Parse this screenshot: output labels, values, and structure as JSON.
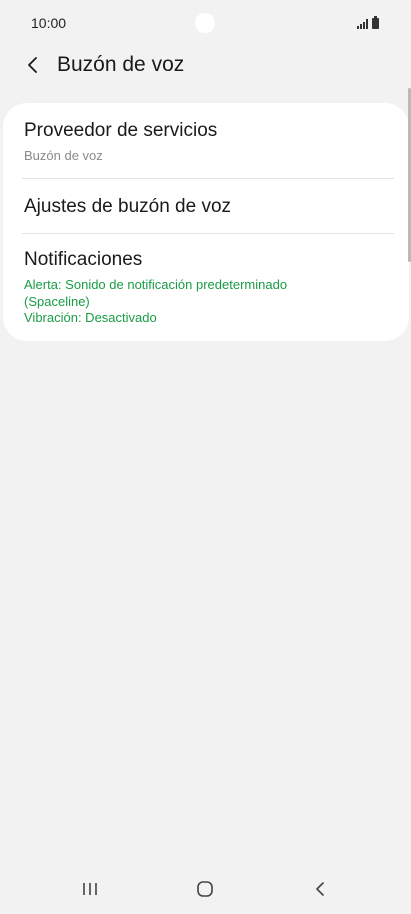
{
  "status_bar": {
    "time": "10:00"
  },
  "header": {
    "title": "Buzón de voz",
    "back_icon": "chevron-left-icon"
  },
  "settings": {
    "items": [
      {
        "title": "Proveedor de servicios",
        "subtitle": "Buzón de voz"
      },
      {
        "title": "Ajustes de buzón de voz"
      },
      {
        "title": "Notificaciones",
        "alert": "Alerta: Sonido de notificación predeterminado (Spaceline)",
        "vibration": "Vibración: Desactivado"
      }
    ]
  },
  "nav_bar": {
    "recents_icon": "recents-icon",
    "home_icon": "home-icon",
    "back_icon": "back-icon"
  },
  "colors": {
    "background": "#f2f2f2",
    "card": "#ffffff",
    "accent_green": "#1a9c46",
    "secondary_text": "#8a8a8a"
  }
}
